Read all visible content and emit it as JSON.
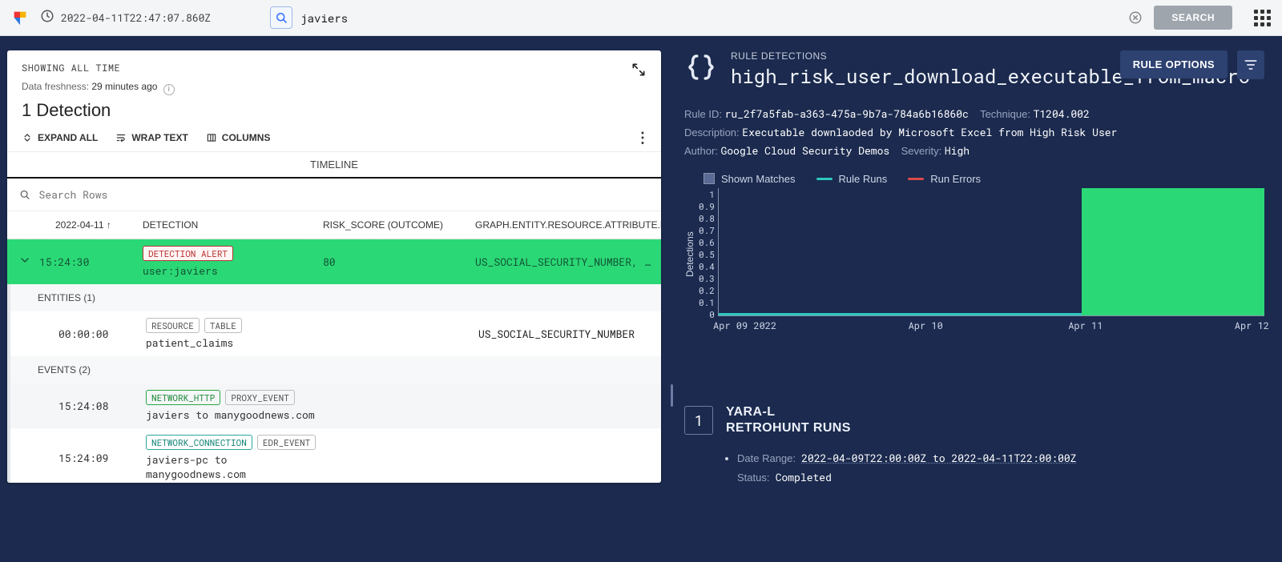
{
  "topbar": {
    "timestamp": "2022-04-11T22:47:07.860Z",
    "search_value": "javiers",
    "search_button": "SEARCH"
  },
  "left": {
    "showing": "SHOWING ALL TIME",
    "freshness_label": "Data freshness: ",
    "freshness_value": "29 minutes ago",
    "detection_count": "1 Detection",
    "toolbar": {
      "expand_all": "EXPAND ALL",
      "wrap_text": "WRAP TEXT",
      "columns": "COLUMNS"
    },
    "timeline_tab": "TIMELINE",
    "search_rows_placeholder": "Search Rows",
    "columns": {
      "c1": "2022-04-11 ↑",
      "c2": "DETECTION",
      "c3": "RISK_SCORE (OUTCOME)",
      "c4": "GRAPH.ENTITY.RESOURCE.ATTRIBUTE.LABELS"
    },
    "alert_row": {
      "time": "15:24:30",
      "badge": "DETECTION ALERT",
      "main": "user:javiers",
      "score": "80",
      "labels": "US_SOCIAL_SECURITY_NUMBER, …"
    },
    "group_entities": "ENTITIES (1)",
    "entity_row": {
      "time": "00:00:00",
      "tag1": "RESOURCE",
      "tag2": "TABLE",
      "main": "patient_claims",
      "labels": "US_SOCIAL_SECURITY_NUMBER"
    },
    "group_events": "EVENTS (2)",
    "event1": {
      "time": "15:24:08",
      "tag1": "NETWORK_HTTP",
      "tag2": "PROXY_EVENT",
      "main": "javiers to manygoodnews.com"
    },
    "event2": {
      "time": "15:24:09",
      "tag1": "NETWORK_CONNECTION",
      "tag2": "EDR_EVENT",
      "main": "javiers-pc to manygoodnews.com"
    }
  },
  "right": {
    "rule_detections": "RULE DETECTIONS",
    "rule_name": "high_risk_user_download_executable_from_macro",
    "rule_options": "RULE OPTIONS",
    "kv": {
      "rule_id_label": "Rule ID:",
      "rule_id": "ru_2f7a5fab-a363-475a-9b7a-784a6b16860c",
      "technique_label": "Technique:",
      "technique": "T1204.002",
      "description_label": "Description:",
      "description": "Executable downlaoded by Microsoft Excel from High Risk User",
      "author_label": "Author:",
      "author": "Google Cloud Security Demos",
      "severity_label": "Severity:",
      "severity": "High"
    },
    "legend": {
      "shown": "Shown Matches",
      "runs": "Rule Runs",
      "errors": "Run Errors"
    },
    "yara": {
      "count": "1",
      "title1": "YARA-L",
      "title2": "RETROHUNT RUNS",
      "daterange_label": "Date Range:",
      "daterange": "2022-04-09T22:00:00Z to 2022-04-11T22:00:00Z",
      "status_label": "Status:",
      "status": "Completed"
    }
  },
  "chart_data": {
    "type": "bar",
    "title": "",
    "ylabel": "Detections",
    "xlabel": "",
    "ylim": [
      0,
      1
    ],
    "yticks": [
      1,
      0.9,
      0.8,
      0.7,
      0.6,
      0.5,
      0.4,
      0.3,
      0.2,
      0.1,
      0
    ],
    "xticks": [
      "Apr 09 2022",
      "Apr 10",
      "Apr 11",
      "Apr 12"
    ],
    "series": [
      {
        "name": "Shown Matches",
        "x": [
          "Apr 09 2022",
          "Apr 10",
          "Apr 11"
        ],
        "values": [
          0,
          0,
          1
        ]
      },
      {
        "name": "Rule Runs",
        "note": "continuous baseline across full range"
      },
      {
        "name": "Run Errors",
        "x": [],
        "values": []
      }
    ]
  }
}
